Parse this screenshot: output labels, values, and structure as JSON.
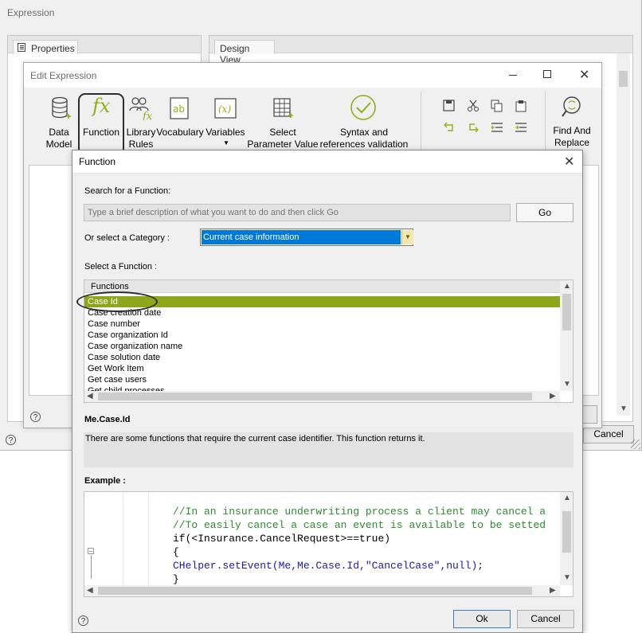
{
  "expression_window": {
    "title": "Expression",
    "properties_tab": "Properties",
    "design_view_tab": "Design View",
    "cancel_label": "Cancel"
  },
  "edit_expression": {
    "title": "Edit Expression",
    "ribbon": [
      {
        "label": "Data Model",
        "icon": "database-icon"
      },
      {
        "label": "Function",
        "icon": "fx-icon"
      },
      {
        "label": "Library Rules",
        "icon": "library-rules-icon"
      },
      {
        "label": "Vocabulary",
        "icon": "vocabulary-icon"
      },
      {
        "label": "Variables",
        "icon": "variables-icon"
      },
      {
        "label": "Select Parameter Value",
        "icon": "parameter-table-icon"
      },
      {
        "label": "Syntax and references validation",
        "icon": "checkmark-circle-icon"
      },
      {
        "label": "Find And Replace",
        "icon": "find-replace-icon"
      }
    ],
    "edit_tools": [
      "save-icon",
      "cut-icon",
      "copy-icon",
      "paste-icon",
      "undo-icon",
      "redo-icon",
      "outdent-icon",
      "indent-icon"
    ]
  },
  "function_dialog": {
    "title": "Function",
    "search_label": "Search for a Function:",
    "search_placeholder": "Type a brief description of what you want to do and then click Go",
    "go_label": "Go",
    "category_label": "Or select a Category :",
    "category_value": "Current case information",
    "select_label": "Select a Function :",
    "list_header": "Functions",
    "functions": [
      "Case Id",
      "Case creation date",
      "Case number",
      "Case organization Id",
      "Case organization name",
      "Case solution date",
      "Get Work Item",
      "Get case users",
      "Get child processes"
    ],
    "selected_function": "Case Id",
    "signature": "Me.Case.Id",
    "description": "There are some functions that require the current case identifier. This function returns it.",
    "example_label": "Example :",
    "example_code": [
      "//In an insurance underwriting process a client may cancel a",
      "//To easily cancel a case an event is available to be setted",
      "if(<Insurance.CancelRequest>==true)",
      "{",
      "CHelper.setEvent(Me,Me.Case.Id,\"CancelCase\",null);",
      "}"
    ],
    "ok_label": "Ok",
    "cancel_label": "Cancel",
    "help_glyph": "?"
  },
  "colors": {
    "selection_green": "#8ea61b",
    "category_highlight": "#0078d7",
    "accent_icon_green": "#8fb01a"
  }
}
